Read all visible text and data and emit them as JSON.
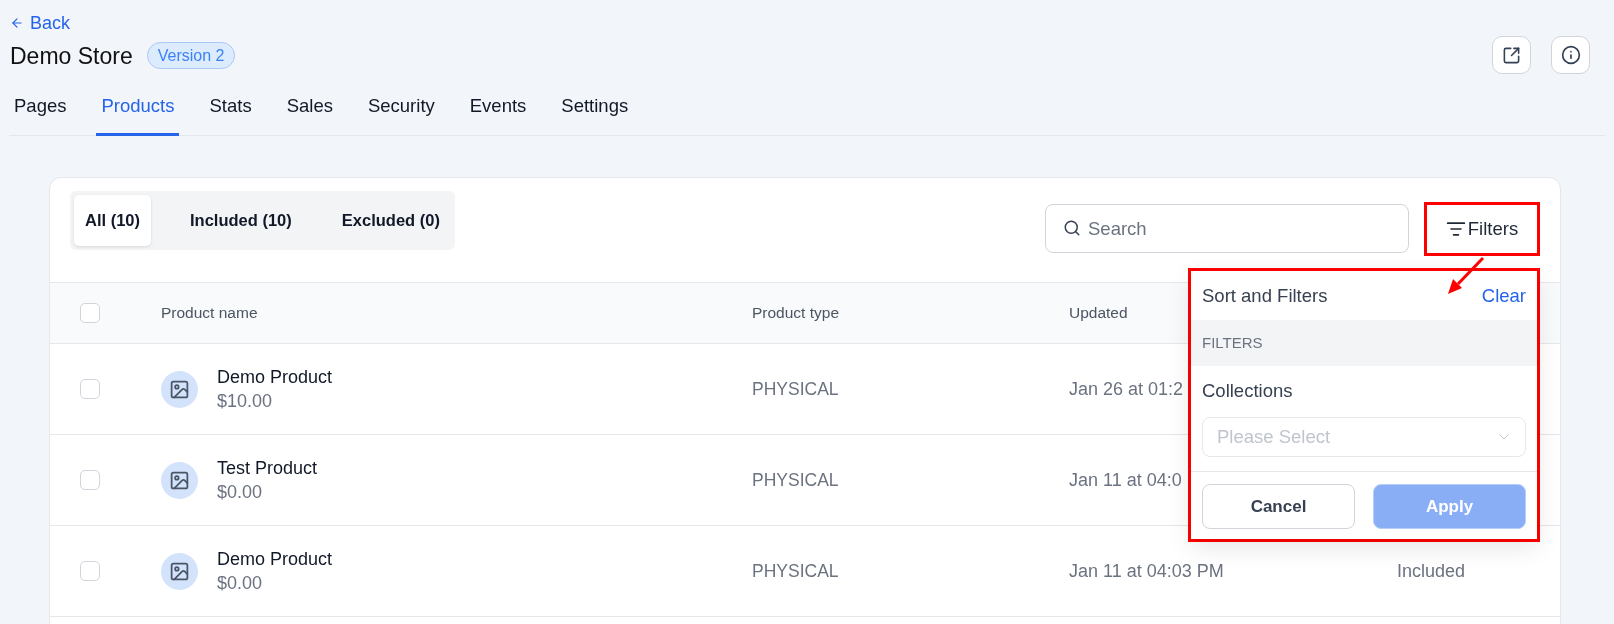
{
  "back_link": {
    "label": "Back"
  },
  "store": {
    "title": "Demo Store",
    "badge": "Version 2"
  },
  "nav_tabs": [
    {
      "label": "Pages",
      "selected": false
    },
    {
      "label": "Products",
      "selected": true
    },
    {
      "label": "Stats",
      "selected": false
    },
    {
      "label": "Sales",
      "selected": false
    },
    {
      "label": "Security",
      "selected": false
    },
    {
      "label": "Events",
      "selected": false
    },
    {
      "label": "Settings",
      "selected": false
    }
  ],
  "product_tabs": [
    {
      "label": "All (10)",
      "selected": true
    },
    {
      "label": "Included (10)",
      "selected": false
    },
    {
      "label": "Excluded (0)",
      "selected": false
    }
  ],
  "search": {
    "placeholder": "Search"
  },
  "filters_button": {
    "label": "Filters"
  },
  "table": {
    "select_all": {
      "checked": false
    },
    "columns": [
      "Product name",
      "Product type",
      "Updated"
    ],
    "rows": [
      {
        "checked": false,
        "name": "Demo Product",
        "price": "$10.00",
        "type": "PHYSICAL",
        "updated": "Jan 26 at 01:2"
      },
      {
        "checked": false,
        "name": "Test Product",
        "price": "$0.00",
        "type": "PHYSICAL",
        "updated": "Jan 11 at 04:0"
      },
      {
        "checked": false,
        "name": "Demo Product",
        "price": "$0.00",
        "type": "PHYSICAL",
        "updated": "Jan 11 at 04:03 PM",
        "status": "Included"
      }
    ]
  },
  "filter_panel": {
    "title": "Sort and Filters",
    "clear_link": "Clear",
    "section_title": "FILTERS",
    "collections": {
      "label": "Collections",
      "placeholder": "Please Select"
    },
    "buttons": [
      {
        "label": "Cancel",
        "kind": "secondary",
        "disabled": false
      },
      {
        "label": "Apply",
        "kind": "primary",
        "disabled": true
      }
    ]
  }
}
